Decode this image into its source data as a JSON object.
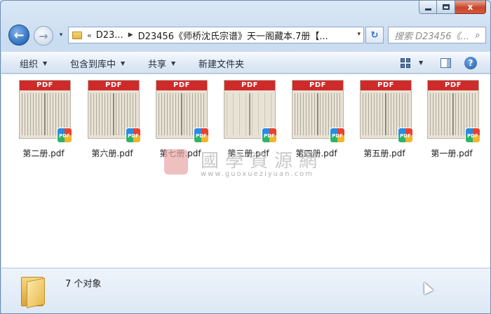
{
  "window": {
    "caption_close": "x"
  },
  "nav": {
    "back_glyph": "←",
    "forward_glyph": "→",
    "dropdown_glyph": "▾"
  },
  "address": {
    "chevron": "«",
    "segments": [
      "D23...",
      "D23456《师桥沈氏宗谱》天一阁藏本.7册【..."
    ],
    "separator": "▶",
    "dropdown_glyph": "▾"
  },
  "refresh_glyph": "↻",
  "search": {
    "placeholder": "搜索 D23456《...",
    "icon": "search-icon"
  },
  "toolbar": {
    "organize_label": "组织",
    "include_label": "包含到库中",
    "share_label": "共享",
    "new_folder_label": "新建文件夹",
    "caret": "▼",
    "help_label": "?"
  },
  "files": [
    {
      "name": "第二册.pdf",
      "thumb_header": "PDF",
      "badge": "PDF",
      "style": "dense"
    },
    {
      "name": "第六册.pdf",
      "thumb_header": "PDF",
      "badge": "PDF",
      "style": "dense"
    },
    {
      "name": "第七册.pdf",
      "thumb_header": "PDF",
      "badge": "PDF",
      "style": "dense"
    },
    {
      "name": "第三册.pdf",
      "thumb_header": "PDF",
      "badge": "PDF",
      "style": "plain"
    },
    {
      "name": "第四册.pdf",
      "thumb_header": "PDF",
      "badge": "PDF",
      "style": "dense"
    },
    {
      "name": "第五册.pdf",
      "thumb_header": "PDF",
      "badge": "PDF",
      "style": "dense"
    },
    {
      "name": "第一册.pdf",
      "thumb_header": "PDF",
      "badge": "PDF",
      "style": "dense"
    }
  ],
  "watermark": {
    "text": "國學資源網",
    "url": "www.guoxueziyuan.com"
  },
  "details": {
    "count_text": "7 个对象"
  },
  "colors": {
    "pdf_header": "#cf2a2a",
    "window_frame": "#c9dcf0",
    "close_button": "#c8452b"
  }
}
